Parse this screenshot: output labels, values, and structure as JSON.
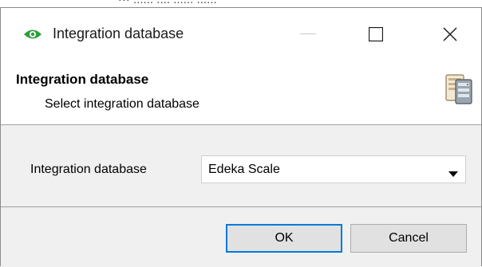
{
  "behind_window": {
    "fragment_text": "··· ...... ....  ......  ......"
  },
  "window": {
    "title": "Integration database",
    "icon": "eye-icon",
    "controls": [
      "minimize-icon",
      "maximize-icon",
      "close-icon"
    ]
  },
  "header": {
    "title": "Integration database",
    "subtitle": "Select integration database",
    "icon": "database-icon"
  },
  "form": {
    "field_label": "Integration database",
    "select_value": "Edeka Scale"
  },
  "buttons": {
    "ok_label": "OK",
    "cancel_label": "Cancel"
  },
  "colors": {
    "accent_border": "#0078d7",
    "eye_icon": "#2e9e3e",
    "panel_bg": "#f0f0f0"
  }
}
